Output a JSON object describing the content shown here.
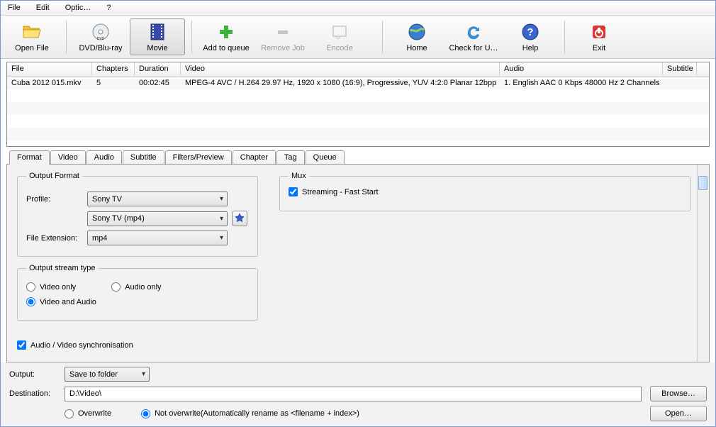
{
  "menubar": {
    "file": "File",
    "edit": "Edit",
    "options": "Optic…",
    "help": "?"
  },
  "toolbar": {
    "open_file": "Open File",
    "dvd_bluray": "DVD/Blu-ray",
    "movie": "Movie",
    "add_to_queue": "Add to queue",
    "remove_job": "Remove Job",
    "encode": "Encode",
    "home": "Home",
    "check_updates": "Check for U…",
    "help": "Help",
    "exit": "Exit"
  },
  "grid": {
    "headers": {
      "file": "File",
      "chapters": "Chapters",
      "duration": "Duration",
      "video": "Video",
      "audio": "Audio",
      "subtitle": "Subtitle"
    },
    "rows": [
      {
        "file": "Cuba 2012 015.mkv",
        "chapters": "5",
        "duration": "00:02:45",
        "video": "MPEG-4 AVC / H.264 29.97 Hz, 1920 x 1080 (16:9), Progressive, YUV 4:2:0 Planar 12bpp",
        "audio": "1. English AAC  0 Kbps 48000 Hz 2 Channels",
        "subtitle": ""
      }
    ]
  },
  "tabs": {
    "format": "Format",
    "video": "Video",
    "audio": "Audio",
    "subtitle": "Subtitle",
    "filters": "Filters/Preview",
    "chapter": "Chapter",
    "tag": "Tag",
    "queue": "Queue"
  },
  "format_panel": {
    "output_format_legend": "Output Format",
    "profile_label": "Profile:",
    "profile_value": "Sony TV",
    "profile_sub_value": "Sony TV (mp4)",
    "file_ext_label": "File Extension:",
    "file_ext_value": "mp4",
    "mux_legend": "Mux",
    "streaming_label": "Streaming - Fast Start",
    "streaming_checked": true,
    "stream_legend": "Output stream type",
    "video_only": "Video only",
    "audio_only": "Audio only",
    "video_audio": "Video and Audio",
    "av_sync_label": "Audio / Video synchronisation",
    "av_sync_checked": true
  },
  "bottom": {
    "output_label": "Output:",
    "output_mode": "Save to folder",
    "destination_label": "Destination:",
    "destination_value": "D:\\Video\\",
    "browse_label": "Browse…",
    "overwrite": "Overwrite",
    "not_overwrite": "Not overwrite(Automatically rename as <filename + index>)",
    "open_label": "Open…"
  }
}
